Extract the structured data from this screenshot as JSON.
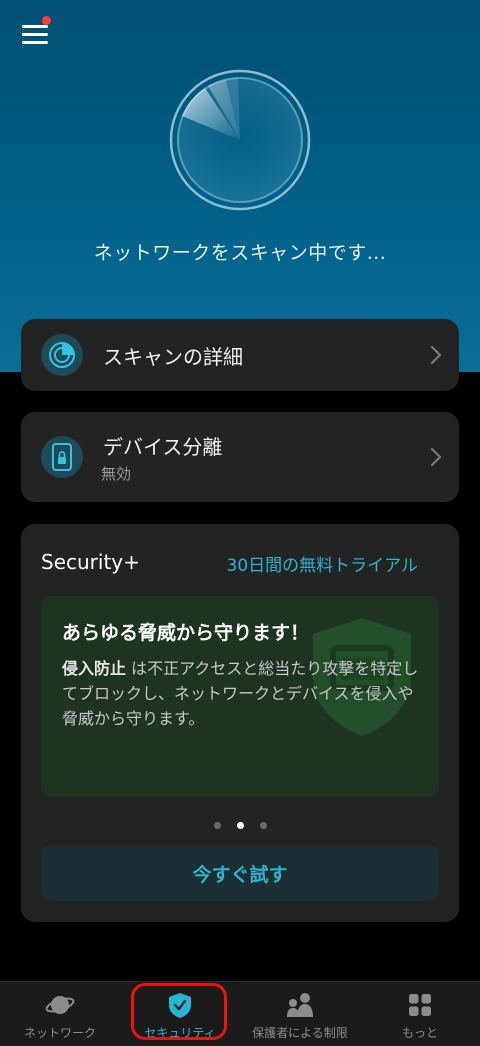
{
  "header": {
    "status_text": "ネットワークをスキャン中です..."
  },
  "cards": {
    "scan_details": {
      "title": "スキャンの詳細"
    },
    "device_isolation": {
      "title": "デバイス分離",
      "status": "無効"
    }
  },
  "security_plus": {
    "title": "Security+",
    "trial_link": "30日間の無料トライアル",
    "promo": {
      "headline": "あらゆる脅威から守ります！",
      "body_highlight": "侵入防止",
      "body_rest": " は不正アクセスと総当たり攻撃を特定してブロックし、ネットワークとデバイスを侵入や脅威から守ります。"
    },
    "carousel": {
      "count": 3,
      "active_index": 1
    },
    "cta_label": "今すぐ試す"
  },
  "tabbar": {
    "items": [
      {
        "label": "ネットワーク",
        "icon": "planet-icon"
      },
      {
        "label": "セキュリティ",
        "icon": "shield-check-icon",
        "active": true
      },
      {
        "label": "保護者による制限",
        "icon": "family-icon"
      },
      {
        "label": "もっと",
        "icon": "grid-icon"
      }
    ]
  },
  "colors": {
    "accent": "#2ab4d4",
    "hero_blue": "#005d85",
    "card_bg": "#232323",
    "promo_bg": "#1f3420",
    "notification": "#ff3b30",
    "highlight_border": "#e8150f"
  }
}
